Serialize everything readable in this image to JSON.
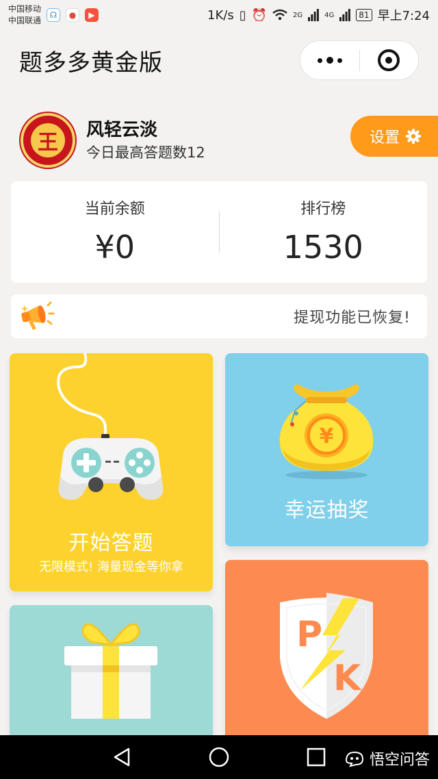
{
  "status_bar": {
    "carrier1": "中国移动",
    "carrier2": "中国联通",
    "speed": "1K/s",
    "signal1": "2G",
    "signal2": "4G",
    "battery": "81",
    "time": "早上7:24"
  },
  "header": {
    "title": "题多多黄金版"
  },
  "profile": {
    "name": "风轻云淡",
    "subtitle": "今日最高答题数12",
    "avatar_char": "王",
    "settings_label": "设置"
  },
  "stats": {
    "balance_label": "当前余额",
    "balance_value": "¥0",
    "rank_label": "排行榜",
    "rank_value": "1530"
  },
  "notice": {
    "text": "提现功能已恢复!"
  },
  "tiles": {
    "start": {
      "title": "开始答题",
      "subtitle": "无限模式! 海量现金等你拿"
    },
    "lottery": {
      "title": "幸运抽奖"
    },
    "pk": {
      "letter_p": "P",
      "letter_k": "K"
    }
  },
  "watermark": {
    "text": "悟空问答"
  },
  "colors": {
    "accent_orange": "#ff9a1a",
    "tile_yellow": "#fdd22e",
    "tile_blue": "#80cfeb",
    "tile_teal": "#9ddad6",
    "tile_orange": "#fd8b51"
  }
}
